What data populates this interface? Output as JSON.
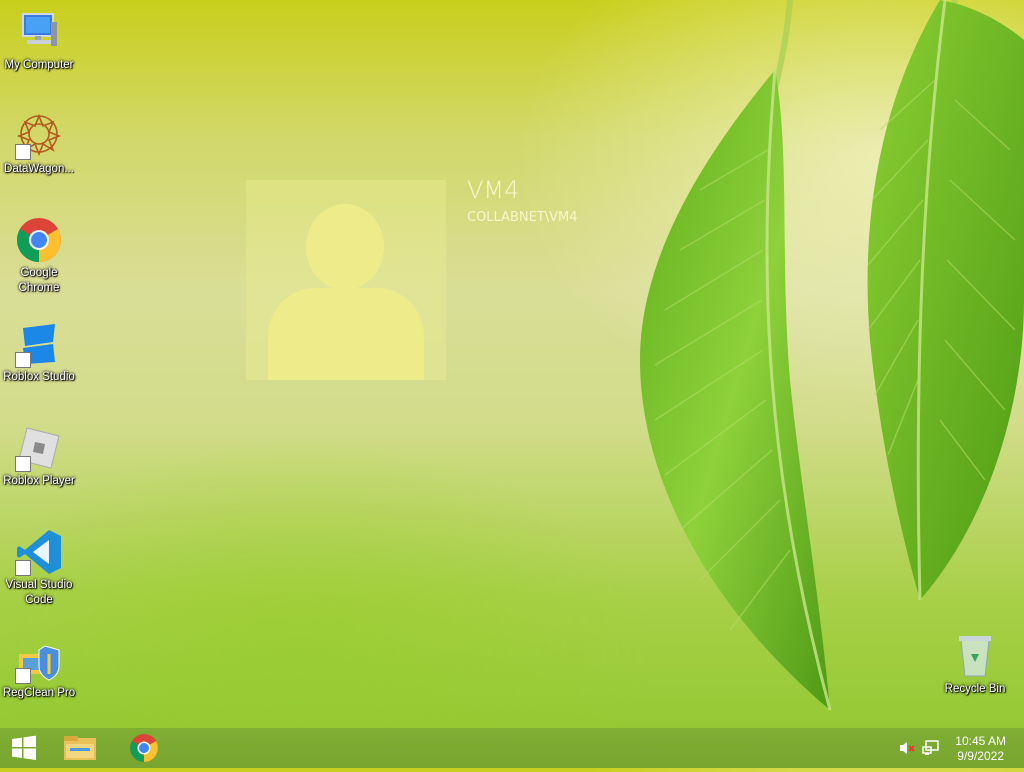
{
  "desktop": {
    "icons": [
      {
        "label": "My Computer"
      },
      {
        "label": "DataWagon..."
      },
      {
        "label": "Google Chrome"
      },
      {
        "label": "Roblox Studio"
      },
      {
        "label": "Roblox Player"
      },
      {
        "label": "Visual Studio Code"
      },
      {
        "label": "RegClean Pro"
      },
      {
        "label": "Recycle Bin"
      }
    ]
  },
  "user": {
    "name": "VM4",
    "domain": "COLLABNET\\VM4"
  },
  "taskbar": {
    "start_icon": "windows-logo-icon",
    "pinned": [
      "file-explorer-icon",
      "chrome-icon"
    ],
    "tray": [
      "volume-muted-icon",
      "network-icon"
    ],
    "clock": {
      "time": "10:45 AM",
      "date": "9/9/2022"
    }
  },
  "colors": {
    "taskbar": "#7fae33",
    "leaf": "#7cc22a"
  }
}
